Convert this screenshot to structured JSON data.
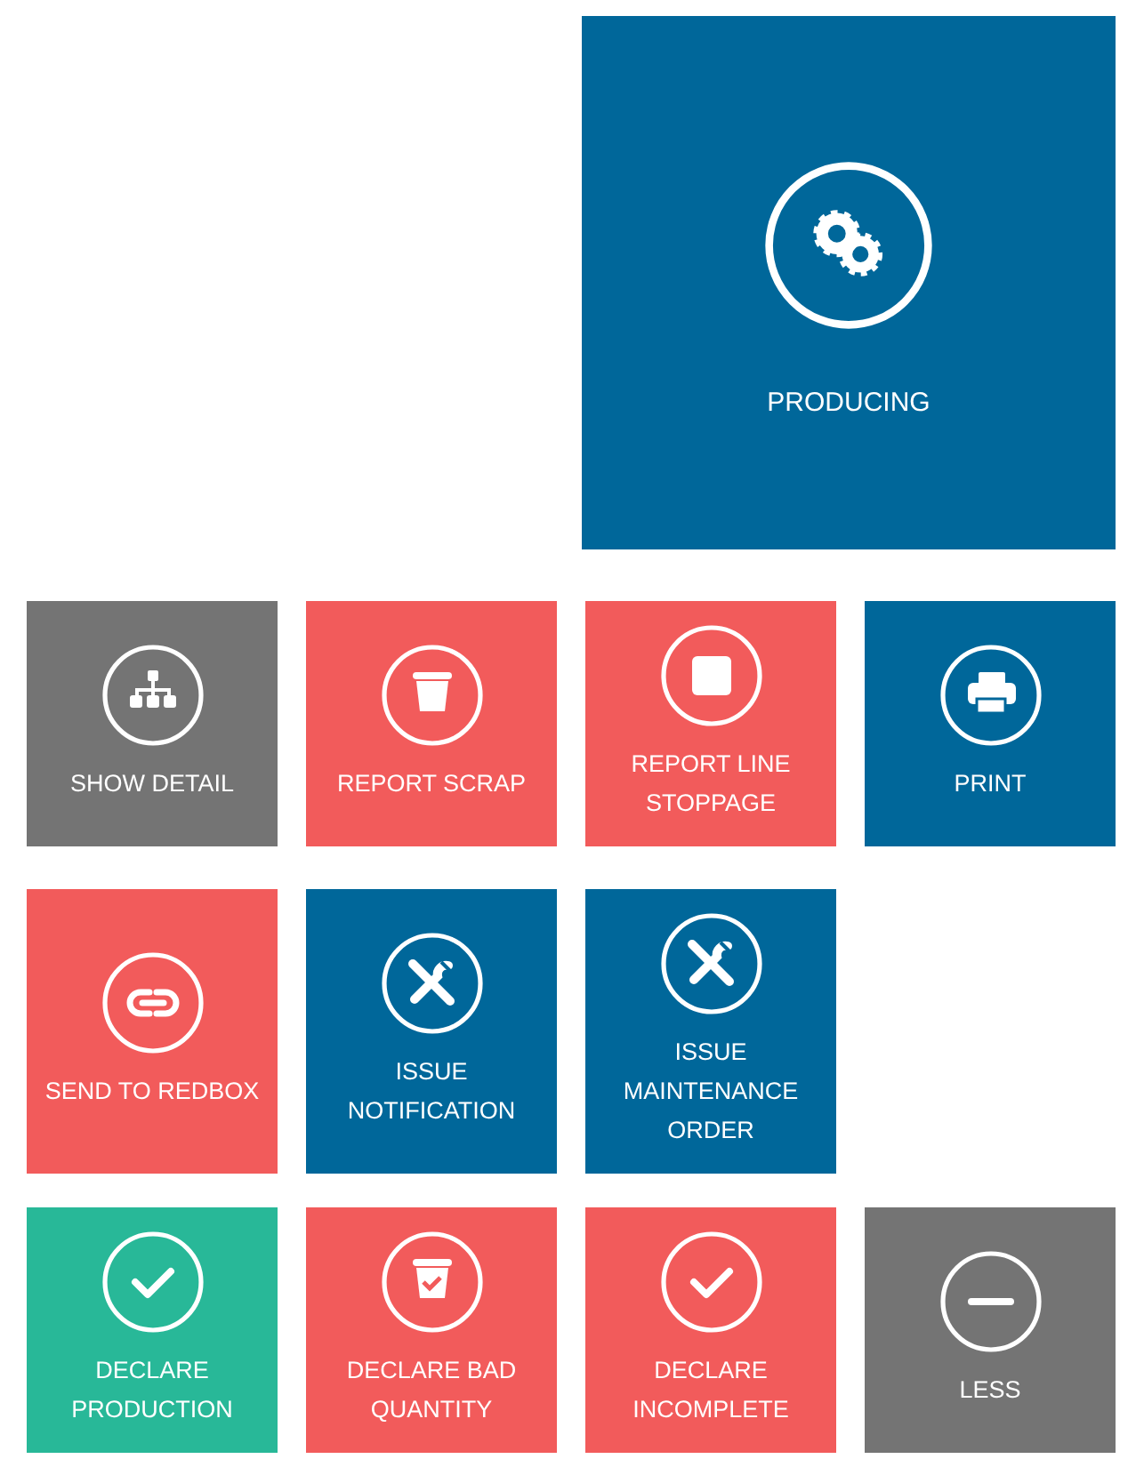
{
  "status_tile": {
    "label": "PRODUCING",
    "kind": "gears",
    "color": "#00679a"
  },
  "rows": [
    {
      "tiles": [
        {
          "label": "SHOW DETAIL",
          "kind": "hierarchy",
          "color": "#747474"
        },
        {
          "label": "REPORT SCRAP",
          "kind": "trash",
          "color": "#f25b5b"
        },
        {
          "label": "REPORT LINE STOPPAGE",
          "kind": "stop",
          "color": "#f25b5b"
        },
        {
          "label": "PRINT",
          "kind": "print",
          "color": "#00679a"
        }
      ]
    },
    {
      "tiles": [
        {
          "label": "SEND TO REDBOX",
          "kind": "link",
          "color": "#f25b5b"
        },
        {
          "label": "ISSUE NOTIFICATION",
          "kind": "tools",
          "color": "#00679a"
        },
        {
          "label": "ISSUE MAINTENANCE ORDER",
          "kind": "tools",
          "color": "#00679a"
        }
      ]
    },
    {
      "tiles": [
        {
          "label": "DECLARE PRODUCTION",
          "kind": "check",
          "color": "#28b898"
        },
        {
          "label": "DECLARE BAD QUANTITY",
          "kind": "trash-check",
          "color": "#f25b5b"
        },
        {
          "label": "DECLARE INCOMPLETE",
          "kind": "check",
          "color": "#f25b5b"
        },
        {
          "label": "LESS",
          "kind": "minus",
          "color": "#747474"
        }
      ]
    }
  ]
}
